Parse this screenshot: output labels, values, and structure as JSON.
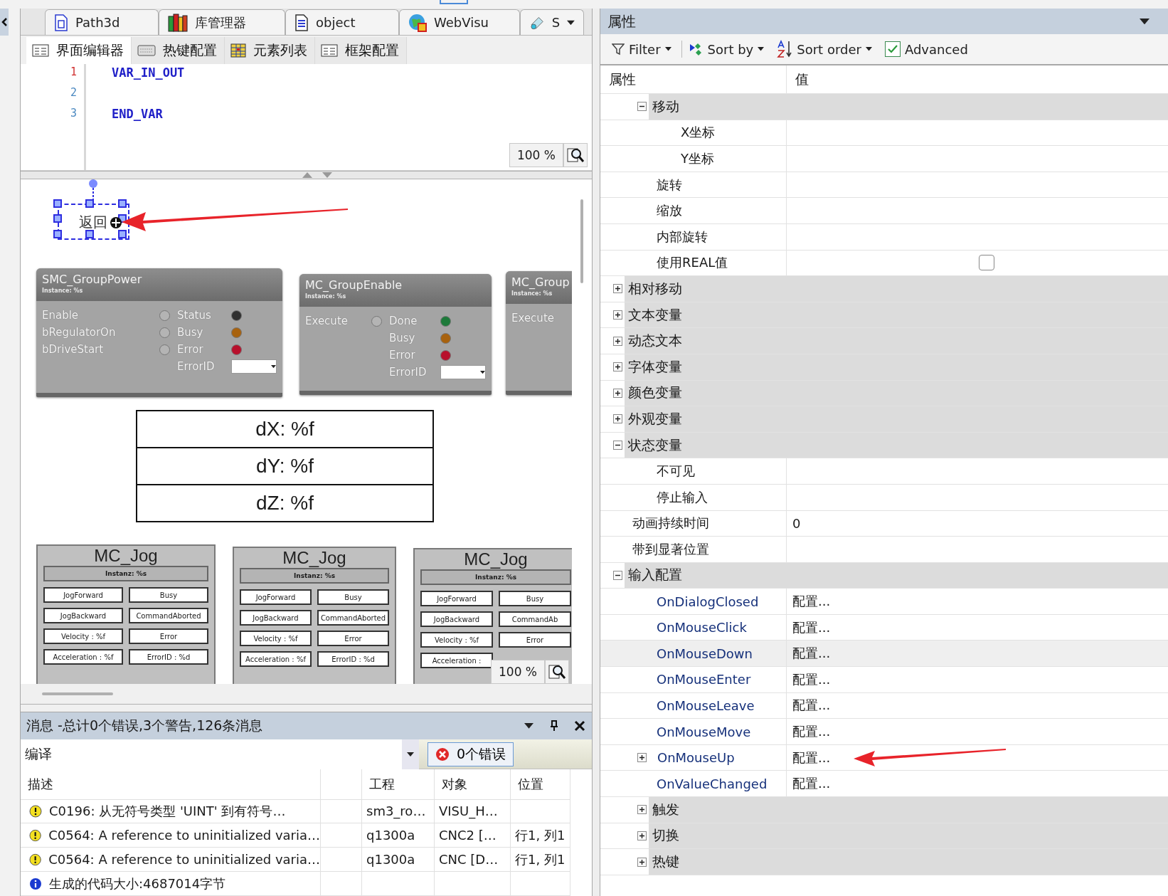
{
  "doc_tabs": [
    {
      "label": "Path3d"
    },
    {
      "label": "库管理器"
    },
    {
      "label": "object"
    },
    {
      "label": "WebVisu"
    },
    {
      "label": "S"
    }
  ],
  "editor_tabs": [
    {
      "label": "界面编辑器",
      "selected": true
    },
    {
      "label": "热键配置",
      "selected": false
    },
    {
      "label": "元素列表",
      "selected": false
    },
    {
      "label": "框架配置",
      "selected": false
    }
  ],
  "code": {
    "lines": [
      {
        "number": "1",
        "text": "VAR_IN_OUT",
        "current": true
      },
      {
        "number": "2",
        "current": false
      },
      {
        "number": "3",
        "text": "END_VAR",
        "current": false
      }
    ],
    "zoom": "100 %"
  },
  "canvas": {
    "selected_element": {
      "label": "返回"
    },
    "function_blocks": [
      {
        "title": "SMC_GroupPower",
        "instance": "Instance: %s",
        "inputs": [
          {
            "label": "Enable",
            "color": "#b4b4b4"
          },
          {
            "label": "bRegulatorOn",
            "color": "#b4b4b4"
          },
          {
            "label": "bDriveStart",
            "color": "#b4b4b4"
          }
        ],
        "outputs": [
          {
            "kind": "lamp",
            "label": "Status",
            "color": "#303030"
          },
          {
            "kind": "lamp",
            "label": "Busy",
            "color": "#a8620e"
          },
          {
            "kind": "lamp",
            "label": "Error",
            "color": "#b8102c"
          },
          {
            "kind": "field",
            "label": "ErrorID"
          }
        ]
      },
      {
        "title": "MC_GroupEnable",
        "instance": "Instance: %s",
        "inputs": [
          {
            "label": "Execute",
            "color": "#b4b4b4"
          }
        ],
        "outputs": [
          {
            "kind": "lamp",
            "label": "Done",
            "color": "#1d7a3a"
          },
          {
            "kind": "lamp",
            "label": "Busy",
            "color": "#a8620e"
          },
          {
            "kind": "lamp",
            "label": "Error",
            "color": "#b8102c"
          },
          {
            "kind": "field",
            "label": "ErrorID"
          }
        ]
      },
      {
        "title": "MC_Group",
        "instance": "Instance: %s",
        "inputs": [
          {
            "label": "Execute"
          }
        ]
      }
    ],
    "display_rows": [
      "dX: %f",
      "dY: %f",
      "dZ: %f"
    ],
    "jog_blocks": [
      {
        "title": "MC_Jog",
        "instance": "Instanz: %s",
        "rows": [
          [
            "JogForward",
            "Busy"
          ],
          [
            "JogBackward",
            "CommandAborted"
          ],
          [
            "Velocity : %f",
            "Error"
          ],
          [
            "Acceleration : %f",
            "ErrorID : %d"
          ]
        ]
      },
      {
        "title": "MC_Jog",
        "instance": "Instanz: %s",
        "rows": [
          [
            "JogForward",
            "Busy"
          ],
          [
            "JogBackward",
            "CommandAborted"
          ],
          [
            "Velocity : %f",
            "Error"
          ],
          [
            "Acceleration : %f",
            "ErrorID : %d"
          ]
        ]
      },
      {
        "title": "MC_Jog",
        "instance": "Instanz: %s",
        "rows": [
          [
            "JogForward",
            "Busy"
          ],
          [
            "JogBackward",
            "CommandAb"
          ],
          [
            "Velocity : %f",
            "Error"
          ],
          [
            "Acceleration :"
          ]
        ]
      }
    ],
    "zoom": "100 %"
  },
  "messages": {
    "title": "消息 -总计0个错误,3个警告,126条消息",
    "category": "编译",
    "errors_button": "0个错误",
    "columns": [
      "描述",
      "工程",
      "对象",
      "位置"
    ],
    "rows": [
      {
        "kind": "warning",
        "description": "C0196:  从无符号类型 'UINT' 到有符号…",
        "project": "sm3_ro…",
        "object": "VISU_H…"
      },
      {
        "kind": "warning",
        "description": "C0564:  A reference to uninitialized varia…",
        "project": "q1300a",
        "object": "CNC2 […",
        "position": "行1, 列1"
      },
      {
        "kind": "warning",
        "description": "C0564:  A reference to uninitialized varia…",
        "project": "q1300a",
        "object": "CNC [D…",
        "position": "行1, 列1"
      },
      {
        "kind": "info",
        "description": "生成的代码大小:4687014字节"
      }
    ]
  },
  "properties": {
    "title": "属性",
    "toolbar": {
      "filter": "Filter",
      "sort_by": "Sort by",
      "sort_order": "Sort order",
      "advanced": {
        "label": "Advanced",
        "checked": true
      }
    },
    "columns": [
      "属性",
      "值"
    ],
    "continued": [
      {
        "kind": "group",
        "label": "移动",
        "expanded": true,
        "children": [
          {
            "kind": "leaf",
            "label": "X坐标"
          },
          {
            "kind": "leaf",
            "label": "Y坐标"
          }
        ]
      },
      {
        "kind": "leaf",
        "label": "旋转"
      },
      {
        "kind": "leaf",
        "label": "缩放"
      },
      {
        "kind": "leaf",
        "label": "内部旋转"
      },
      {
        "kind": "checkbox",
        "label": "使用REAL值",
        "checked": false
      }
    ],
    "rows": [
      {
        "kind": "group",
        "label": "相对移动",
        "expanded": false
      },
      {
        "kind": "group",
        "label": "文本变量",
        "expanded": false
      },
      {
        "kind": "group",
        "label": "动态文本",
        "expanded": false
      },
      {
        "kind": "group",
        "label": "字体变量",
        "expanded": false
      },
      {
        "kind": "group",
        "label": "颜色变量",
        "expanded": false
      },
      {
        "kind": "group",
        "label": "外观变量",
        "expanded": false
      },
      {
        "kind": "group",
        "label": "状态变量",
        "expanded": true,
        "children": [
          {
            "kind": "leaf",
            "label": "不可见"
          },
          {
            "kind": "leaf",
            "label": "停止输入"
          }
        ]
      },
      {
        "kind": "leaf",
        "label": "动画持续时间",
        "value": "0"
      },
      {
        "kind": "leaf",
        "label": "带到显著位置"
      },
      {
        "kind": "group",
        "label": "输入配置",
        "expanded": true,
        "children": [
          {
            "kind": "leaf",
            "label": "OnDialogClosed",
            "value": "配置...",
            "selected": false
          },
          {
            "kind": "leaf",
            "label": "OnMouseClick",
            "value": "配置...",
            "selected": false
          },
          {
            "kind": "leaf",
            "label": "OnMouseDown",
            "value": "配置...",
            "selected": true
          },
          {
            "kind": "leaf",
            "label": "OnMouseEnter",
            "value": "配置...",
            "selected": false
          },
          {
            "kind": "leaf",
            "label": "OnMouseLeave",
            "value": "配置...",
            "selected": false
          },
          {
            "kind": "leaf",
            "label": "OnMouseMove",
            "value": "配置...",
            "selected": false
          },
          {
            "kind": "leaf",
            "label": "OnMouseUp",
            "value": "配置...",
            "expanded": false,
            "selected": false
          },
          {
            "kind": "leaf",
            "label": "OnValueChanged",
            "value": "配置...",
            "selected": false
          }
        ]
      }
    ],
    "continued_after": [
      {
        "kind": "group",
        "label": "触发",
        "expanded": false
      },
      {
        "kind": "group",
        "label": "切换",
        "expanded": false
      },
      {
        "kind": "group",
        "label": "热键",
        "expanded": false
      }
    ]
  }
}
